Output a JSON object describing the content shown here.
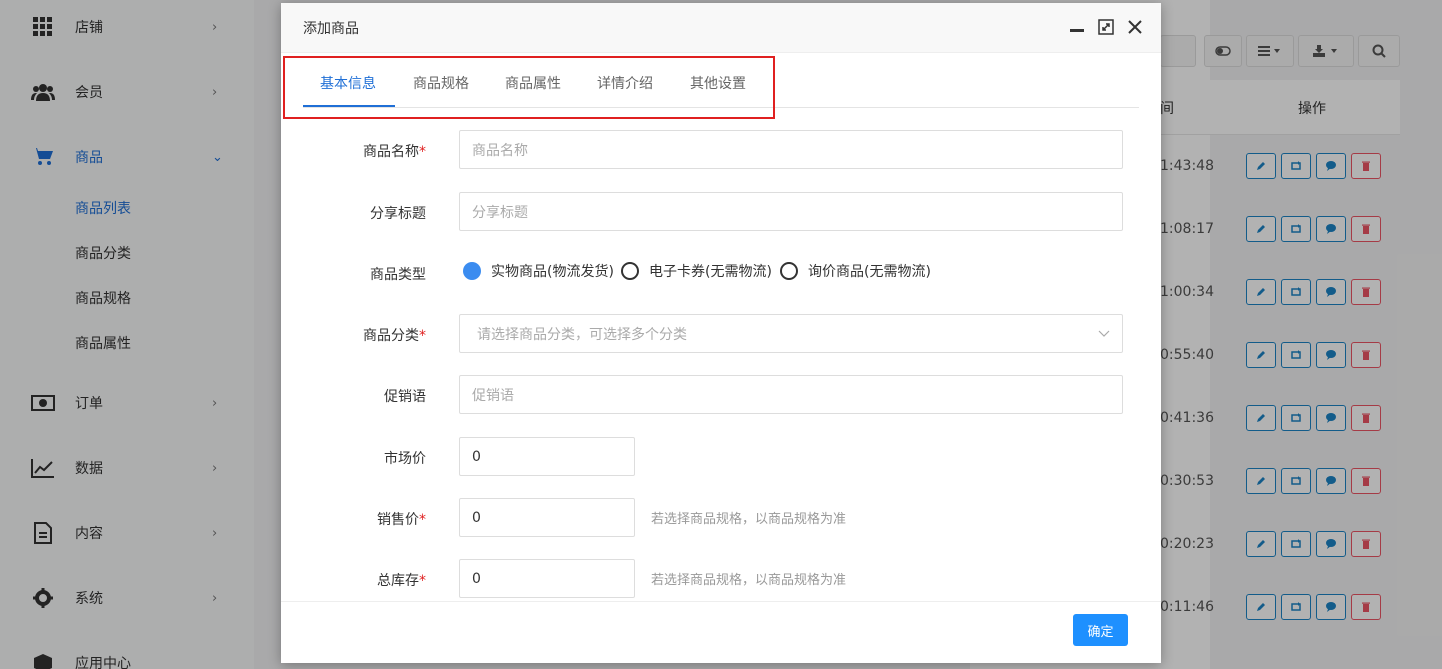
{
  "sidebar": {
    "items": [
      {
        "label": "店铺",
        "icon": "grid-icon"
      },
      {
        "label": "会员",
        "icon": "users-icon"
      },
      {
        "label": "商品",
        "icon": "cart-icon"
      },
      {
        "label": "订单",
        "icon": "money-icon"
      },
      {
        "label": "数据",
        "icon": "chart-line-icon"
      },
      {
        "label": "内容",
        "icon": "document-icon"
      },
      {
        "label": "系统",
        "icon": "gear-icon"
      },
      {
        "label": "应用中心",
        "icon": "cube-icon"
      }
    ],
    "sub_items": [
      "商品列表",
      "商品分类",
      "商品规格",
      "商品属性"
    ]
  },
  "background": {
    "column_header": "操作",
    "column_header_partial": "间",
    "times": [
      "1:43:48",
      "1:08:17",
      "1:00:34",
      "0:55:40",
      "0:41:36",
      "0:30:53",
      "0:20:23",
      "0:11:46"
    ]
  },
  "modal": {
    "title": "添加商品",
    "tabs": [
      "基本信息",
      "商品规格",
      "商品属性",
      "详情介绍",
      "其他设置"
    ],
    "fields": {
      "name_label": "商品名称",
      "name_placeholder": "商品名称",
      "share_label": "分享标题",
      "share_placeholder": "分享标题",
      "type_label": "商品类型",
      "type_options": [
        "实物商品(物流发货)",
        "电子卡券(无需物流)",
        "询价商品(无需物流)"
      ],
      "category_label": "商品分类",
      "category_placeholder": "请选择商品分类，可选择多个分类",
      "promo_label": "促销语",
      "promo_placeholder": "促销语",
      "market_price_label": "市场价",
      "market_price_value": "0",
      "sale_price_label": "销售价",
      "sale_price_value": "0",
      "sale_price_hint": "若选择商品规格，以商品规格为准",
      "stock_label": "总库存",
      "stock_value": "0",
      "stock_hint": "若选择商品规格，以商品规格为准"
    },
    "required_mark": "*",
    "confirm_label": "确定"
  },
  "colors": {
    "accent": "#1f6fd6",
    "highlight": "#e02020",
    "confirm": "#1e90ff"
  }
}
